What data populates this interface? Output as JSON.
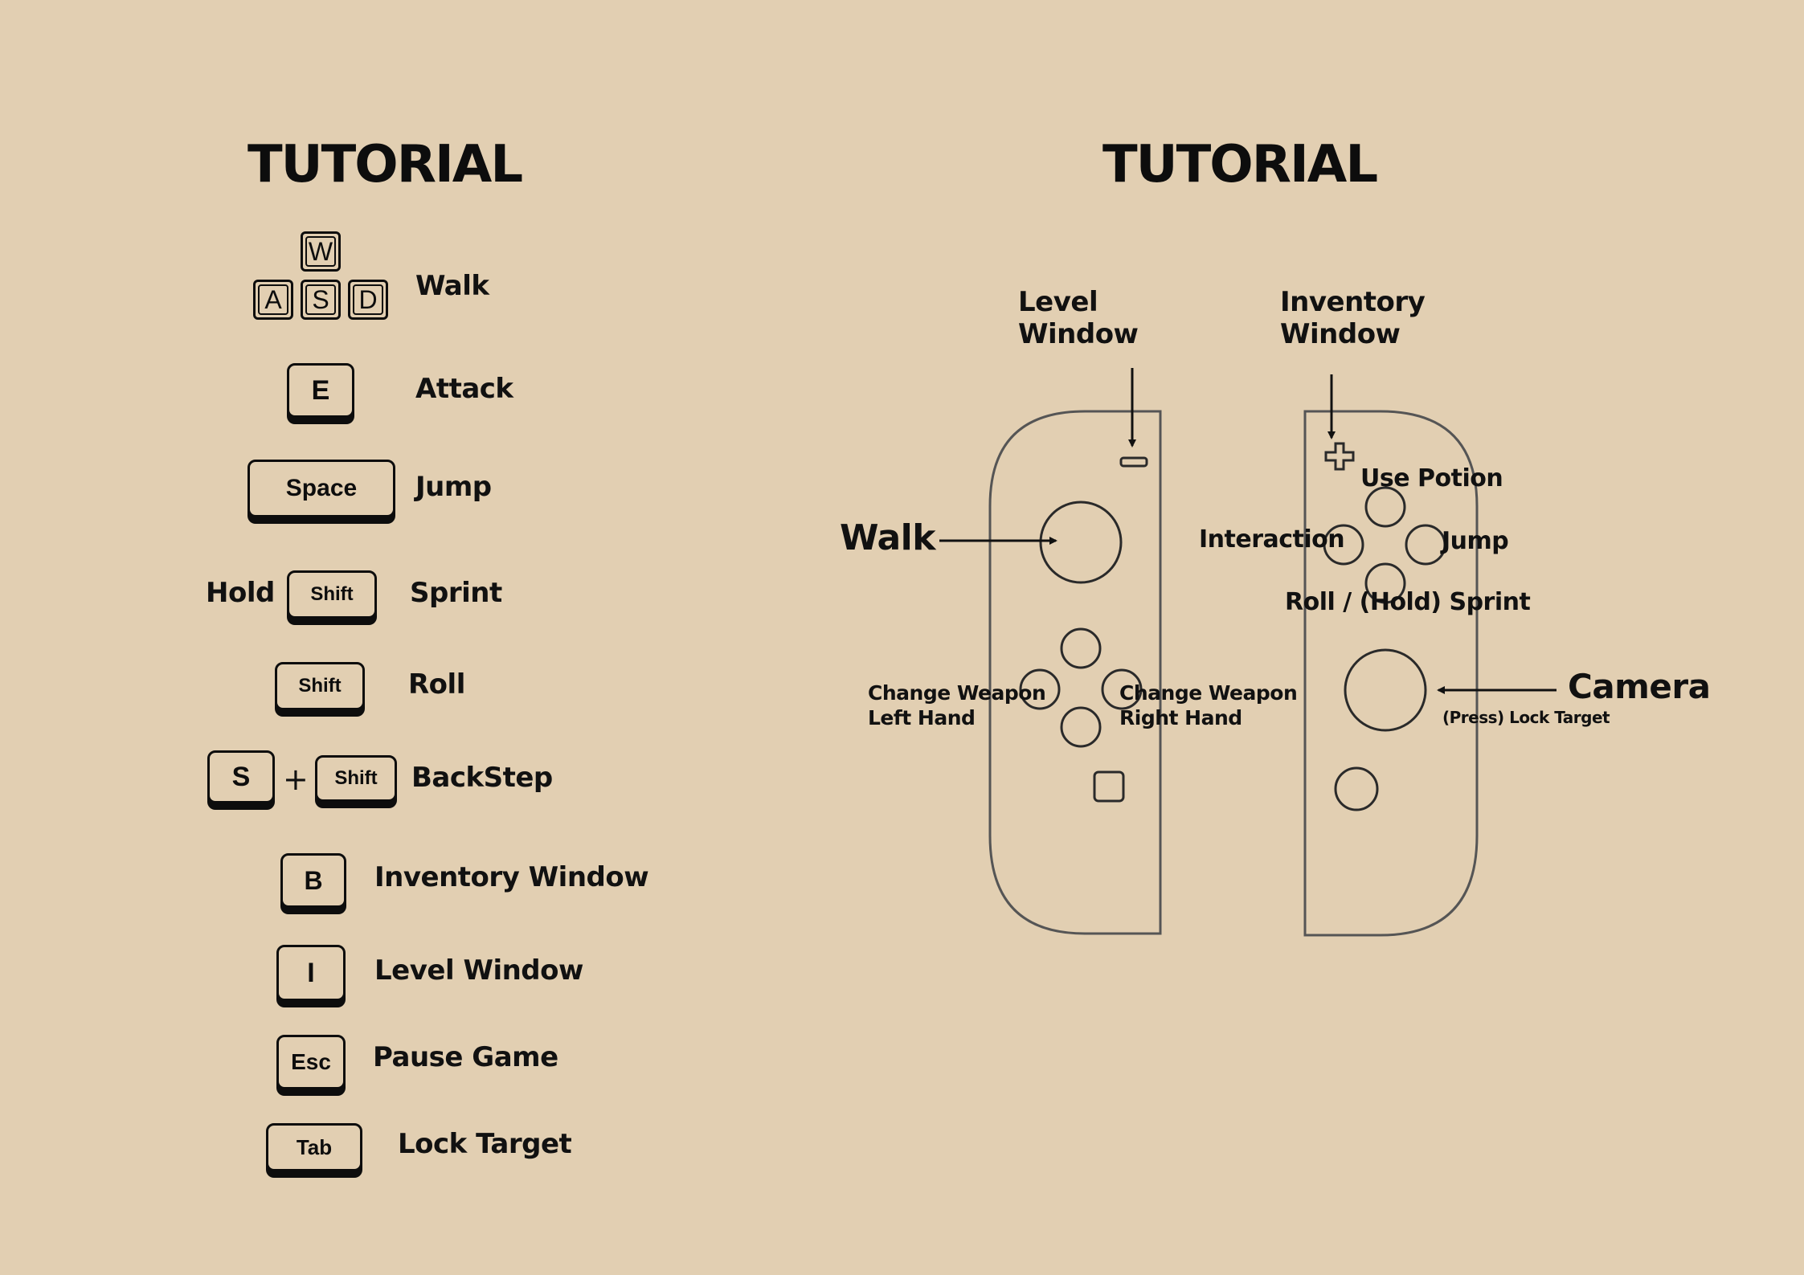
{
  "left": {
    "title": "TUTORIAL",
    "keys": {
      "w": "W",
      "a": "A",
      "s": "S",
      "d": "D",
      "e": "E",
      "space": "Space",
      "shift_sprint": "Shift",
      "shift_roll": "Shift",
      "s_backstep": "S",
      "plus": "+",
      "shift_backstep": "Shift",
      "b": "B",
      "i": "I",
      "esc": "Esc",
      "tab": "Tab"
    },
    "labels": {
      "walk": "Walk",
      "attack": "Attack",
      "jump": "Jump",
      "hold": "Hold",
      "sprint": "Sprint",
      "roll": "Roll",
      "backstep": "BackStep",
      "inventory": "Inventory Window",
      "level": "Level Window",
      "pause": "Pause Game",
      "lock": "Lock Target"
    }
  },
  "right": {
    "title": "TUTORIAL",
    "labels": {
      "level_window_1": "Level",
      "level_window_2": "Window",
      "inventory_window_1": "Inventory",
      "inventory_window_2": "Window",
      "walk": "Walk",
      "interaction": "Interaction",
      "use_potion": "Use Potion",
      "jump": "Jump",
      "roll_sprint": "Roll / (Hold) Sprint",
      "change_left_1": "Change Weapon",
      "change_left_2": "Left Hand",
      "change_right_1": "Change Weapon",
      "change_right_2": "Right Hand",
      "camera": "Camera",
      "lock_target": "(Press) Lock Target"
    }
  }
}
